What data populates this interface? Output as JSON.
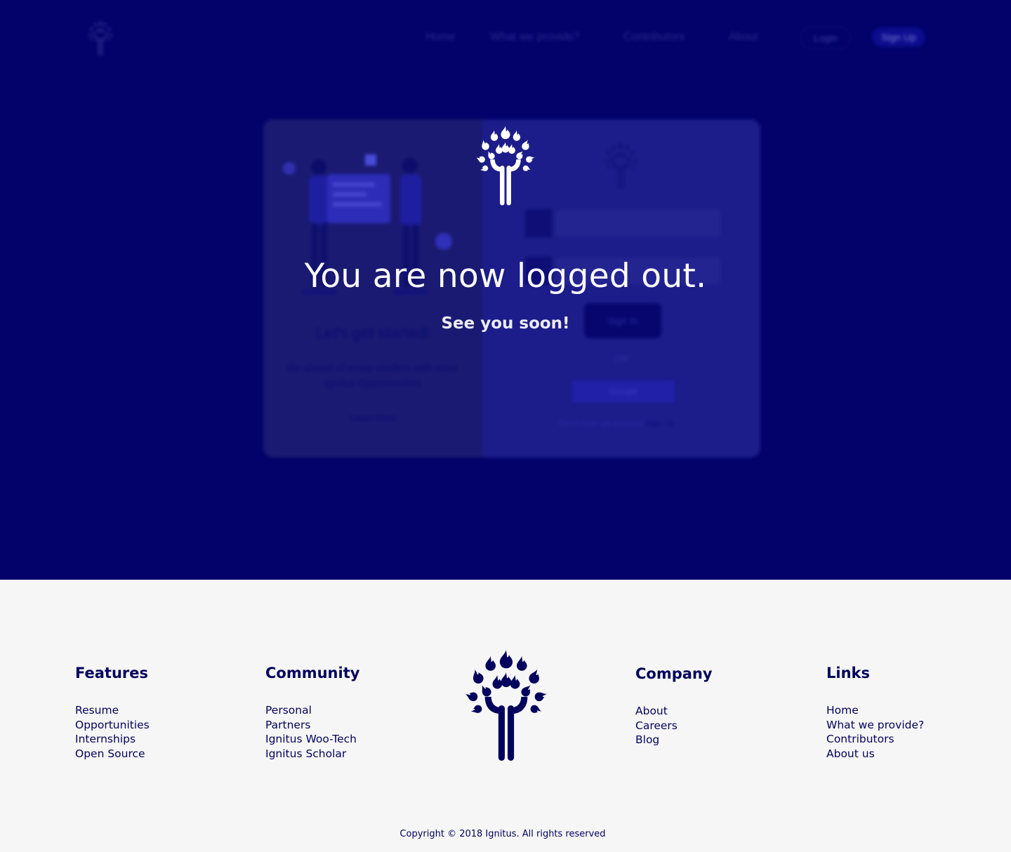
{
  "nav": {
    "items": [
      "Home",
      "What we provide?",
      "Contributors",
      "About"
    ],
    "login_label": "Login",
    "signup_label": "Sign Up"
  },
  "background_card": {
    "heading": "Let's get started!",
    "description_line1": "Be ahead of every student with most",
    "description_line2": "Ignitus Opportunities",
    "learn_more": "Learn More",
    "signin_label": "Sign In",
    "or_label": "OR",
    "google_label": "Google",
    "no_account": "Don't have an account?",
    "signup_link": "Sign Up"
  },
  "modal": {
    "title": "You are now logged out.",
    "subtitle": "See you soon!"
  },
  "footer": {
    "features": {
      "heading": "Features",
      "links": [
        "Resume",
        "Opportunities",
        "Internships",
        "Open Source"
      ]
    },
    "community": {
      "heading": "Community",
      "links": [
        "Personal",
        "Partners",
        "Ignitus Woo-Tech",
        "Ignitus Scholar"
      ]
    },
    "company": {
      "heading": "Company",
      "links": [
        "About",
        "Careers",
        "Blog"
      ]
    },
    "links": {
      "heading": "Links",
      "links": [
        "Home",
        "What we provide?",
        "Contributors",
        "About us"
      ]
    },
    "copyright": "Copyright © 2018 Ignitus. All rights reserved"
  },
  "colors": {
    "overlay_navy": "#02026a",
    "brand_navy": "#02025c",
    "footer_bg": "#f6f6f6",
    "modal_text": "#ffffff"
  },
  "icons": {
    "brand_logo": "ignitus-flame-tree-icon"
  }
}
